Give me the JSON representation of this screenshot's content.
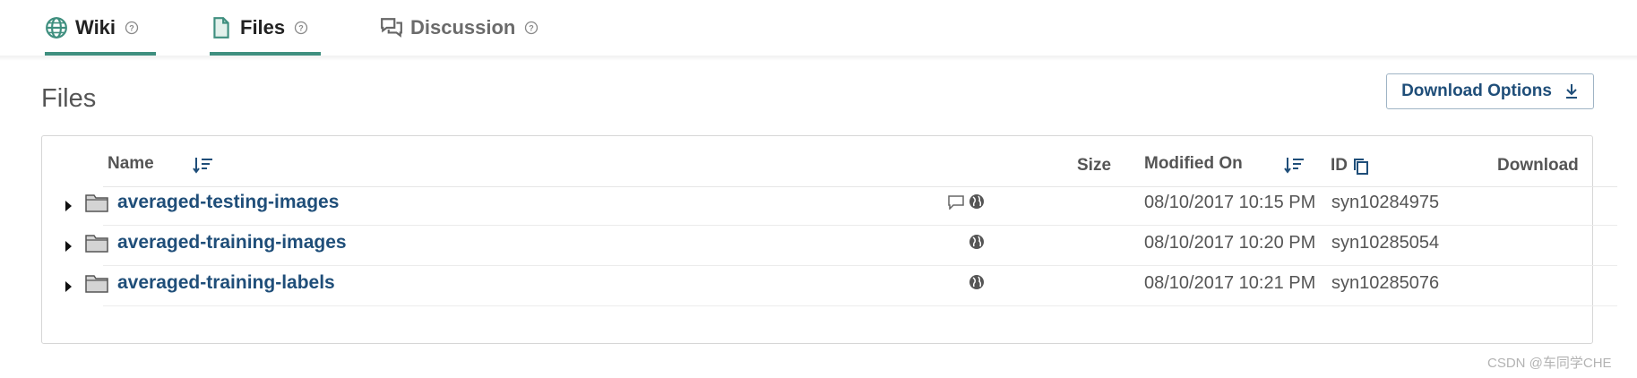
{
  "tabs": {
    "wiki": "Wiki",
    "files": "Files",
    "discussion": "Discussion"
  },
  "section_title": "Files",
  "download_options_label": "Download Options",
  "table": {
    "headers": {
      "name": "Name",
      "size": "Size",
      "modified": "Modified On",
      "id": "ID",
      "download": "Download"
    },
    "rows": [
      {
        "name": "averaged-testing-images",
        "modified": "08/10/2017 10:15 PM",
        "id": "syn10284975"
      },
      {
        "name": "averaged-training-images",
        "modified": "08/10/2017 10:20 PM",
        "id": "syn10285054"
      },
      {
        "name": "averaged-training-labels",
        "modified": "08/10/2017 10:21 PM",
        "id": "syn10285076"
      }
    ]
  },
  "watermark": "CSDN @车同学CHE",
  "colors": {
    "accent": "#3f8f7f",
    "link": "#1f4e79"
  }
}
